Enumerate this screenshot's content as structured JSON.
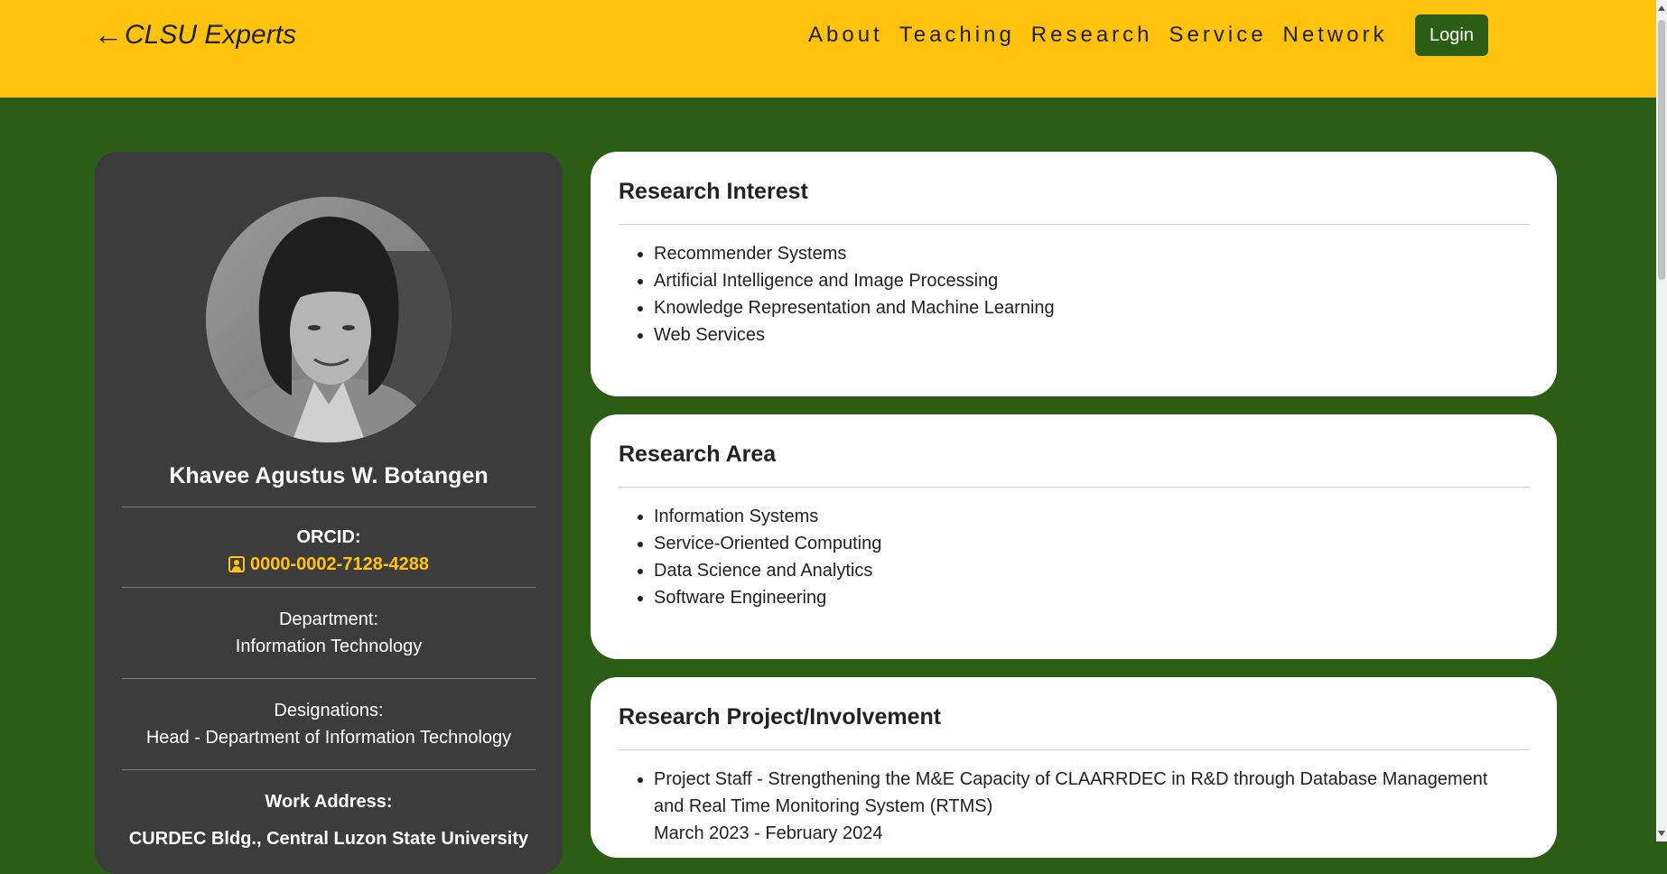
{
  "header": {
    "back_arrow": "←",
    "brand": "CLSU Experts",
    "nav": [
      "About",
      "Teaching",
      "Research",
      "Service",
      "Network"
    ],
    "login": "Login"
  },
  "profile": {
    "name": "Khavee Agustus W. Botangen",
    "orcid_label": "ORCID:",
    "orcid_id": "0000-0002-7128-4288",
    "department_label": "Department:",
    "department": "Information Technology",
    "designations_label": "Designations:",
    "designation": "Head - Department of Information Technology",
    "work_address_label": "Work Address:",
    "work_address": "CURDEC Bldg., Central Luzon State University"
  },
  "research_interest": {
    "title": "Research Interest",
    "items": [
      "Recommender Systems",
      "Artificial Intelligence and Image Processing",
      "Knowledge Representation and Machine Learning",
      "Web Services"
    ]
  },
  "research_area": {
    "title": "Research Area",
    "items": [
      "Information Systems",
      "Service-Oriented Computing",
      "Data Science and Analytics",
      "Software Engineering"
    ]
  },
  "research_projects": {
    "title": "Research Project/Involvement",
    "items": [
      {
        "text": "Project Staff - Strengthening the M&E Capacity of CLAARRDEC in R&D through Database Management and Real Time Monitoring System (RTMS)",
        "period": "March 2023 - February 2024"
      }
    ]
  },
  "colors": {
    "header_bg": "#ffc20e",
    "page_bg": "#2b5e14",
    "profile_bg": "#3c3c3c",
    "accent": "#ffc20e"
  },
  "icons": {
    "orcid": "id-badge-icon",
    "avatar": "profile-photo"
  }
}
